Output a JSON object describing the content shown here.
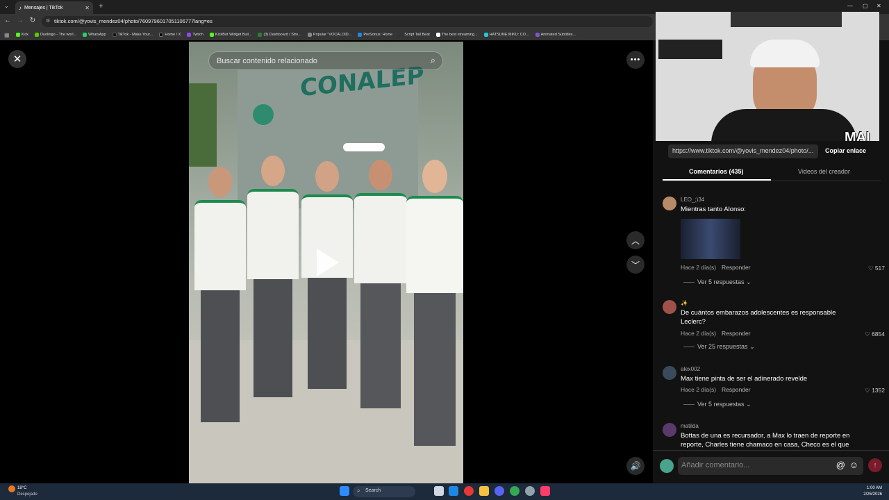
{
  "browser": {
    "tab_title": "Mensajes | TikTok",
    "url": "tiktok.com/@yovis_mendez04/photo/7609796017051106777lang=es",
    "bookmarks": [
      "Kick",
      "Duolingo - The worl...",
      "WhatsApp",
      "TikTok - Make Your...",
      "Home / X",
      "Twitch",
      "KickBot Widget Buil...",
      "(3) Dashboard / Stre...",
      "Popular \"VOCALOID...",
      "PreSonus: Home",
      "Script Tall Beat",
      "The best streaming...",
      "HATSUNE MIKU: CO...",
      "Animated Subtitles..."
    ]
  },
  "viewer": {
    "search_placeholder": "Buscar contenido relacionado",
    "sign_text": "CONALEP"
  },
  "panel": {
    "overlay_label": "MAI",
    "share_url": "https://www.tiktok.com/@yovis_mendez04/photo/...",
    "copy_label": "Copiar enlace",
    "tab_comments": "Comentarios (435)",
    "tab_creator": "Videos del creador",
    "comments": [
      {
        "user": "LEO_;)34",
        "text": "Mientras tanto Alonso:",
        "time": "Hace 2 día(s)",
        "reply": "Responder",
        "likes": "517",
        "replies": "Ver 5 respuestas"
      },
      {
        "user": "✨",
        "text": "De cuántos embarazos adolescentes es responsable Leclerc?",
        "time": "Hace 2 día(s)",
        "reply": "Responder",
        "likes": "6854",
        "replies": "Ver 25 respuestas"
      },
      {
        "user": "alex002",
        "text": "Max tiene pinta de ser el adinerado revelde",
        "time": "Hace 2 día(s)",
        "reply": "Responder",
        "likes": "1352",
        "replies": "Ver 5 respuestas"
      },
      {
        "user": "matilda",
        "text": "Bottas de una es recursador, a Max lo traen de reporte en reporte, Charles tiene chamaco en casa, Checo es el que"
      }
    ],
    "add_comment_placeholder": "Añadir comentario..."
  },
  "taskbar": {
    "weather_temp": "18°C",
    "weather_desc": "Despejado",
    "search_label": "Search",
    "time": "1:00 AM",
    "date": "2/26/2026"
  },
  "colors": {
    "accent": "#fe2c55",
    "taskbar": "#1c2a3c"
  }
}
